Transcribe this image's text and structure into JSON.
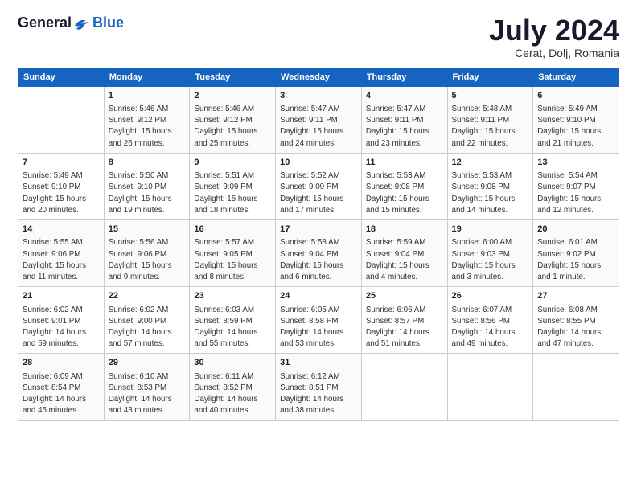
{
  "logo": {
    "text_general": "General",
    "text_blue": "Blue"
  },
  "title": "July 2024",
  "subtitle": "Cerat, Dolj, Romania",
  "days_header": [
    "Sunday",
    "Monday",
    "Tuesday",
    "Wednesday",
    "Thursday",
    "Friday",
    "Saturday"
  ],
  "weeks": [
    [
      {
        "num": "",
        "info": ""
      },
      {
        "num": "1",
        "info": "Sunrise: 5:46 AM\nSunset: 9:12 PM\nDaylight: 15 hours\nand 26 minutes."
      },
      {
        "num": "2",
        "info": "Sunrise: 5:46 AM\nSunset: 9:12 PM\nDaylight: 15 hours\nand 25 minutes."
      },
      {
        "num": "3",
        "info": "Sunrise: 5:47 AM\nSunset: 9:11 PM\nDaylight: 15 hours\nand 24 minutes."
      },
      {
        "num": "4",
        "info": "Sunrise: 5:47 AM\nSunset: 9:11 PM\nDaylight: 15 hours\nand 23 minutes."
      },
      {
        "num": "5",
        "info": "Sunrise: 5:48 AM\nSunset: 9:11 PM\nDaylight: 15 hours\nand 22 minutes."
      },
      {
        "num": "6",
        "info": "Sunrise: 5:49 AM\nSunset: 9:10 PM\nDaylight: 15 hours\nand 21 minutes."
      }
    ],
    [
      {
        "num": "7",
        "info": "Sunrise: 5:49 AM\nSunset: 9:10 PM\nDaylight: 15 hours\nand 20 minutes."
      },
      {
        "num": "8",
        "info": "Sunrise: 5:50 AM\nSunset: 9:10 PM\nDaylight: 15 hours\nand 19 minutes."
      },
      {
        "num": "9",
        "info": "Sunrise: 5:51 AM\nSunset: 9:09 PM\nDaylight: 15 hours\nand 18 minutes."
      },
      {
        "num": "10",
        "info": "Sunrise: 5:52 AM\nSunset: 9:09 PM\nDaylight: 15 hours\nand 17 minutes."
      },
      {
        "num": "11",
        "info": "Sunrise: 5:53 AM\nSunset: 9:08 PM\nDaylight: 15 hours\nand 15 minutes."
      },
      {
        "num": "12",
        "info": "Sunrise: 5:53 AM\nSunset: 9:08 PM\nDaylight: 15 hours\nand 14 minutes."
      },
      {
        "num": "13",
        "info": "Sunrise: 5:54 AM\nSunset: 9:07 PM\nDaylight: 15 hours\nand 12 minutes."
      }
    ],
    [
      {
        "num": "14",
        "info": "Sunrise: 5:55 AM\nSunset: 9:06 PM\nDaylight: 15 hours\nand 11 minutes."
      },
      {
        "num": "15",
        "info": "Sunrise: 5:56 AM\nSunset: 9:06 PM\nDaylight: 15 hours\nand 9 minutes."
      },
      {
        "num": "16",
        "info": "Sunrise: 5:57 AM\nSunset: 9:05 PM\nDaylight: 15 hours\nand 8 minutes."
      },
      {
        "num": "17",
        "info": "Sunrise: 5:58 AM\nSunset: 9:04 PM\nDaylight: 15 hours\nand 6 minutes."
      },
      {
        "num": "18",
        "info": "Sunrise: 5:59 AM\nSunset: 9:04 PM\nDaylight: 15 hours\nand 4 minutes."
      },
      {
        "num": "19",
        "info": "Sunrise: 6:00 AM\nSunset: 9:03 PM\nDaylight: 15 hours\nand 3 minutes."
      },
      {
        "num": "20",
        "info": "Sunrise: 6:01 AM\nSunset: 9:02 PM\nDaylight: 15 hours\nand 1 minute."
      }
    ],
    [
      {
        "num": "21",
        "info": "Sunrise: 6:02 AM\nSunset: 9:01 PM\nDaylight: 14 hours\nand 59 minutes."
      },
      {
        "num": "22",
        "info": "Sunrise: 6:02 AM\nSunset: 9:00 PM\nDaylight: 14 hours\nand 57 minutes."
      },
      {
        "num": "23",
        "info": "Sunrise: 6:03 AM\nSunset: 8:59 PM\nDaylight: 14 hours\nand 55 minutes."
      },
      {
        "num": "24",
        "info": "Sunrise: 6:05 AM\nSunset: 8:58 PM\nDaylight: 14 hours\nand 53 minutes."
      },
      {
        "num": "25",
        "info": "Sunrise: 6:06 AM\nSunset: 8:57 PM\nDaylight: 14 hours\nand 51 minutes."
      },
      {
        "num": "26",
        "info": "Sunrise: 6:07 AM\nSunset: 8:56 PM\nDaylight: 14 hours\nand 49 minutes."
      },
      {
        "num": "27",
        "info": "Sunrise: 6:08 AM\nSunset: 8:55 PM\nDaylight: 14 hours\nand 47 minutes."
      }
    ],
    [
      {
        "num": "28",
        "info": "Sunrise: 6:09 AM\nSunset: 8:54 PM\nDaylight: 14 hours\nand 45 minutes."
      },
      {
        "num": "29",
        "info": "Sunrise: 6:10 AM\nSunset: 8:53 PM\nDaylight: 14 hours\nand 43 minutes."
      },
      {
        "num": "30",
        "info": "Sunrise: 6:11 AM\nSunset: 8:52 PM\nDaylight: 14 hours\nand 40 minutes."
      },
      {
        "num": "31",
        "info": "Sunrise: 6:12 AM\nSunset: 8:51 PM\nDaylight: 14 hours\nand 38 minutes."
      },
      {
        "num": "",
        "info": ""
      },
      {
        "num": "",
        "info": ""
      },
      {
        "num": "",
        "info": ""
      }
    ]
  ]
}
